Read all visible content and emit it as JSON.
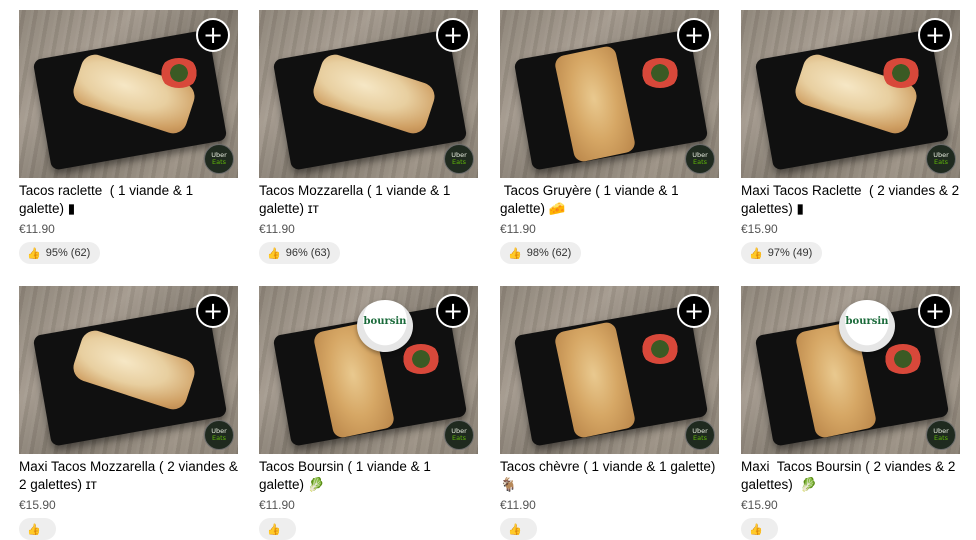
{
  "common": {
    "add_symbol": "+",
    "badge_line1": "Uber",
    "badge_line2": "Eats",
    "thumb_icon": "👍",
    "plate_logo": "boursin"
  },
  "items": [
    {
      "title": "Tacos raclette  ( 1 viande & 1 galette) ▮",
      "price": "€11.90",
      "rating": "95% (62)"
    },
    {
      "title": "Tacos Mozzarella ( 1 viande & 1 galette) ɪᴛ",
      "price": "€11.90",
      "rating": "96% (63)"
    },
    {
      "title": " Tacos Gruyère ( 1 viande & 1 galette) 🧀",
      "price": "€11.90",
      "rating": "98% (62)"
    },
    {
      "title": "Maxi Tacos Raclette  ( 2 viandes & 2 galettes) ▮",
      "price": "€15.90",
      "rating": "97% (49)"
    },
    {
      "title": "Maxi Tacos Mozzarella ( 2 viandes & 2 galettes) ɪᴛ",
      "price": "€15.90",
      "rating": ""
    },
    {
      "title": "Tacos Boursin ( 1 viande & 1 galette) 🥬",
      "price": "€11.90",
      "rating": ""
    },
    {
      "title": "Tacos chèvre ( 1 viande & 1 galette) 🐐",
      "price": "€11.90",
      "rating": ""
    },
    {
      "title": "Maxi  Tacos Boursin ( 2 viandes & 2 galettes)  🥬",
      "price": "€15.90",
      "rating": ""
    }
  ]
}
